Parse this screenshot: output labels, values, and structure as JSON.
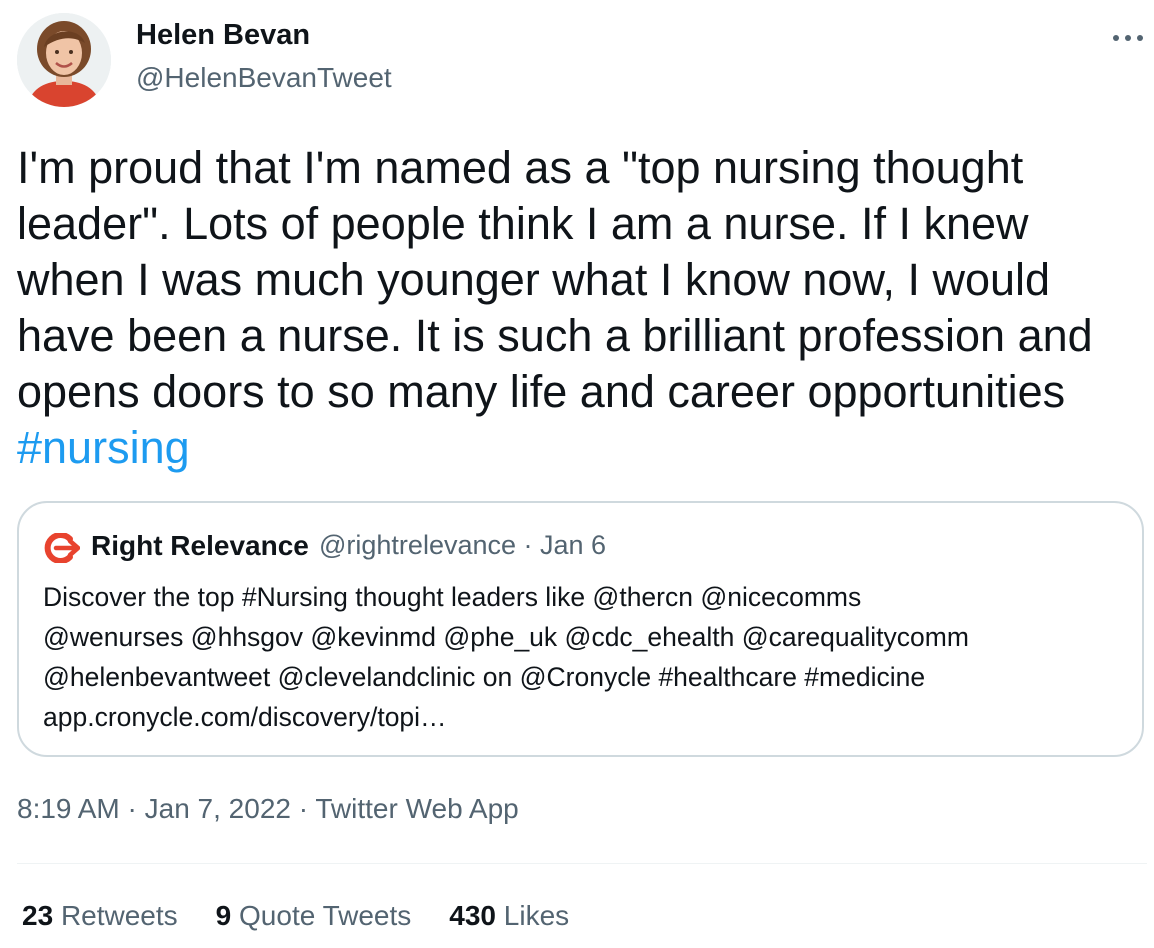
{
  "tweet": {
    "author_name": "Helen Bevan",
    "author_handle": "@HelenBevanTweet",
    "text": "I'm proud that I'm named as a \"top nursing thought\nleader\". Lots of people think I am a nurse. If I knew\nwhen I was much younger what I know now, I would\nhave been a nurse. It is such a brilliant profession and\nopens doors to so many life and career opportunities\n",
    "hashtag": "#nursing",
    "more_icon": "ellipsis-icon",
    "avatar_icon": "profile-photo"
  },
  "quote": {
    "logo_icon": "right-relevance-logo",
    "author_name": "Right Relevance",
    "meta": "@rightrelevance · Jan 6",
    "text": "Discover the top #Nursing thought leaders like @thercn @nicecomms\n@wenurses @hhsgov @kevinmd @phe_uk @cdc_ehealth @carequalitycomm\n@helenbevantweet @clevelandclinic on @Cronycle #healthcare #medicine\napp.cronycle.com/discovery/topi…"
  },
  "meta": {
    "time": "8:19 AM",
    "sep1": " · ",
    "date": "Jan 7, 2022",
    "sep2": " · ",
    "source": "Twitter Web App"
  },
  "stats": {
    "retweets_count": "23",
    "retweets_label": "Retweets",
    "quotes_count": "9",
    "quotes_label": "Quote Tweets",
    "likes_count": "430",
    "likes_label": "Likes"
  },
  "colors": {
    "link": "#1d9bf0",
    "secondary_text": "#536471",
    "primary_text": "#0f1419",
    "border": "#cfd9de",
    "brand_red": "#e8432e"
  }
}
